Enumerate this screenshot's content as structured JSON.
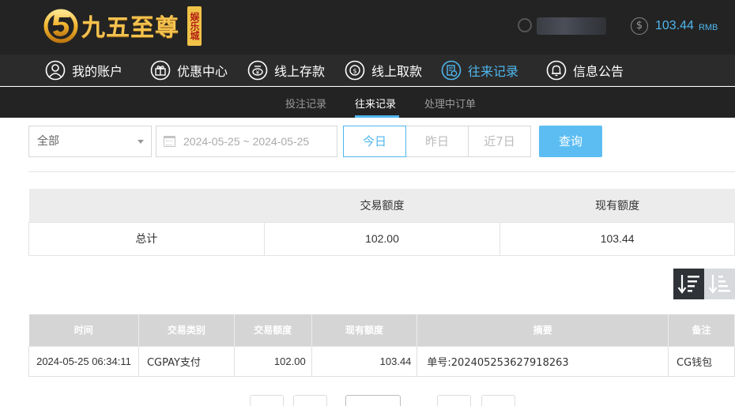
{
  "brand": {
    "name": "九五至尊",
    "badge": "娱乐城",
    "colors": {
      "gold": "#f3c24f",
      "badge_bg": "#f0c247",
      "badge_text": "#b21e14"
    }
  },
  "header": {
    "balance_icon": "dollar-icon",
    "balance_amount": "103.44",
    "balance_unit": "RMB",
    "accent_color": "#4fb6ee"
  },
  "main_nav": [
    {
      "label": "我的账户",
      "icon": "user-icon",
      "active": false
    },
    {
      "label": "优惠中心",
      "icon": "gift-icon",
      "active": false
    },
    {
      "label": "线上存款",
      "icon": "deposit-icon",
      "active": false
    },
    {
      "label": "线上取款",
      "icon": "withdraw-icon",
      "active": false
    },
    {
      "label": "往来记录",
      "icon": "records-icon",
      "active": true
    },
    {
      "label": "信息公告",
      "icon": "bell-icon",
      "active": false
    }
  ],
  "sub_nav": [
    {
      "label": "投注记录",
      "active": false
    },
    {
      "label": "往来记录",
      "active": true
    },
    {
      "label": "处理中订单",
      "active": false
    }
  ],
  "filters": {
    "type_select": "全部",
    "date_range": "2024-05-25 ~ 2024-05-25",
    "quick_ranges": [
      {
        "label": "今日",
        "active": true
      },
      {
        "label": "昨日",
        "active": false
      },
      {
        "label": "近7日",
        "active": false
      }
    ],
    "query_label": "查询"
  },
  "summary": {
    "headers": [
      "",
      "交易额度",
      "现有额度"
    ],
    "total_label": "总计",
    "total_amount": "102.00",
    "current_balance": "103.44"
  },
  "sort": {
    "desc_icon": "sort-desc-icon",
    "asc_icon": "sort-asc-icon"
  },
  "records": {
    "headers": [
      "时间",
      "交易类别",
      "交易额度",
      "现有额度",
      "摘要",
      "备注"
    ],
    "rows": [
      {
        "time": "2024-05-25 06:34:11",
        "type": "CGPAY支付",
        "amount": "102.00",
        "balance": "103.44",
        "summary": "单号:202405253627918263",
        "note": "CG钱包"
      }
    ]
  }
}
